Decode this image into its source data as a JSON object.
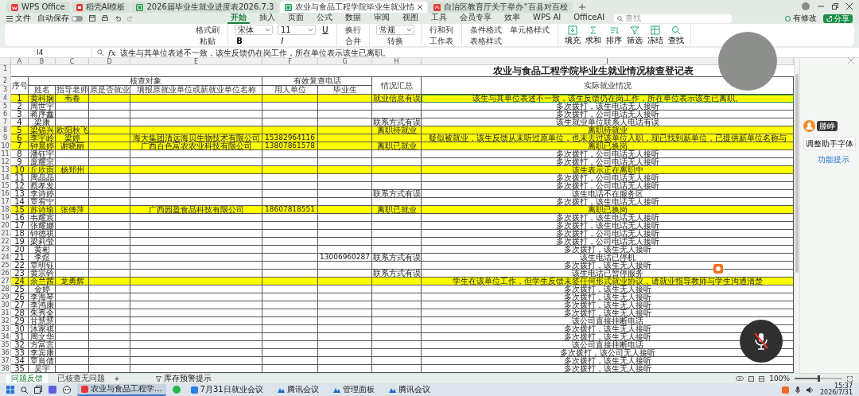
{
  "window_tabs": [
    {
      "label": "WPS Office",
      "kind": "home",
      "selected": false
    },
    {
      "label": "稻壳AI模板",
      "kind": "doc",
      "selected": false
    },
    {
      "label": "2026届毕业生就业进度表2026.7.3",
      "kind": "sheet",
      "selected": false
    },
    {
      "label": "农业与食品工程学院毕业生就业情",
      "kind": "sheet",
      "selected": true
    },
    {
      "label": "自治区教育厅关于举办“百县对百校",
      "kind": "pdf",
      "selected": false
    }
  ],
  "menu": {
    "file": "文件",
    "autosave": {
      "label": "自动保存",
      "on": false
    },
    "tabs": [
      {
        "label": "开始",
        "selected": true
      },
      {
        "label": "插入",
        "selected": false
      },
      {
        "label": "页面",
        "selected": false
      },
      {
        "label": "公式",
        "selected": false
      },
      {
        "label": "数据",
        "selected": false
      },
      {
        "label": "审阅",
        "selected": false
      },
      {
        "label": "视图",
        "selected": false
      },
      {
        "label": "工具",
        "selected": false
      },
      {
        "label": "会员专享",
        "selected": false
      },
      {
        "label": "效率",
        "selected": false
      },
      {
        "label": "WPS AI",
        "selected": false
      },
      {
        "label": "OfficeAI",
        "selected": false
      }
    ],
    "search": {
      "placeholder": "查找"
    },
    "changes": "有修改",
    "share": "分享"
  },
  "ribbon": [
    {
      "items": [
        {
          "kind": "button",
          "label": "格式刷"
        },
        {
          "kind": "button",
          "label": "粘贴"
        }
      ]
    },
    {
      "items": [
        {
          "kind": "select",
          "value": "宋体"
        },
        {
          "kind": "format",
          "label": "B"
        },
        {
          "kind": "select",
          "value": "11"
        },
        {
          "kind": "format",
          "label": "I"
        },
        {
          "kind": "format",
          "label": "U"
        }
      ]
    },
    {
      "items": [
        {
          "kind": "button",
          "label": "换行"
        },
        {
          "kind": "button",
          "label": "合并"
        }
      ]
    },
    {
      "items": [
        {
          "kind": "select",
          "value": "常规"
        },
        {
          "kind": "button",
          "label": "转换"
        }
      ]
    },
    {
      "items": [
        {
          "kind": "button",
          "label": "行和列"
        },
        {
          "kind": "button",
          "label": "工作表"
        }
      ]
    },
    {
      "items": [
        {
          "kind": "button",
          "label": "条件格式"
        },
        {
          "kind": "button",
          "label": "表格样式"
        },
        {
          "kind": "button",
          "label": "单元格样式"
        }
      ]
    },
    {
      "items": [
        {
          "kind": "large",
          "label": "填充"
        },
        {
          "kind": "large",
          "label": "求和"
        },
        {
          "kind": "large",
          "label": "排序"
        },
        {
          "kind": "large",
          "label": "筛选"
        },
        {
          "kind": "large",
          "label": "冻结"
        },
        {
          "kind": "large",
          "label": "查找"
        }
      ]
    }
  ],
  "formula_bar": {
    "cell": "I4",
    "fx": "fx",
    "formula": "该生与其单位表述不一致，该生反馈仍在岗工作，所在单位表示该生已离职。"
  },
  "sheet": {
    "column_letters": [
      "A",
      "B",
      "C",
      "D",
      "E",
      "F",
      "G",
      "H",
      "I"
    ],
    "header_row_numbers": [
      "1",
      "2",
      "3"
    ],
    "title": "农业与食品工程学院毕业生就业情况核查登记表",
    "seq_header": "序号",
    "group_headers": [
      "核查对象",
      "有效复查电话"
    ],
    "column_headers": [
      "姓名",
      "指导老师",
      "原是否就业",
      "填报原就业单位或新就业单位名称",
      "用人单位",
      "毕业生"
    ],
    "summary_header": "情况汇总",
    "actual_header": "实际就业情况",
    "rows": [
      {
        "row": "4",
        "seq": "1",
        "name": "黄科娴",
        "teacher": "韦春",
        "summary": "就业信息有误",
        "actual": "该生与其单位表述不一致，该生反馈仍在岗工作，所在单位表示该生已离职。",
        "highlighted": true,
        "selected": true
      },
      {
        "row": "5",
        "seq": "2",
        "name": "周世宇",
        "actual": "多次拨打，该生电话无人接听",
        "highlighted": false,
        "selected": false
      },
      {
        "row": "6",
        "seq": "3",
        "name": "蒋序鑫",
        "actual": "多次拨打，公司电话无人接听",
        "highlighted": false,
        "selected": false
      },
      {
        "row": "7",
        "seq": "4",
        "name": "梁康",
        "summary": "联系方式有误",
        "actual": "该生就业单位联系人电话有误",
        "highlighted": false,
        "selected": false
      },
      {
        "row": "8",
        "seq": "5",
        "name": "梁锦兴",
        "teacher": "欧阳秋飞",
        "summary": "离职待就业",
        "actual": "离职待就业",
        "highlighted": true,
        "selected": false
      },
      {
        "row": "9",
        "seq": "6",
        "name": "李宇岭",
        "teacher": "梁婷",
        "company": "海大集团清远海贝生物技术有限公司",
        "employer_phone": "15382964116",
        "actual": "疑似被就业，该生反馈从未听过原单位，也未去过该单位入职，现已找到新单位，已提供新单位名称与",
        "highlighted": true,
        "selected": false
      },
      {
        "row": "10",
        "seq": "7",
        "name": "钟晨婷",
        "teacher": "谢晓丽",
        "company": "广西百色富农农业科技有限公司",
        "employer_phone": "13807861578",
        "summary": "离职已就业",
        "actual": "离职已换岗",
        "highlighted": true,
        "selected": false
      },
      {
        "row": "11",
        "seq": "8",
        "name": "潘钰宇",
        "actual": "多次拨打，公司电话无人接听",
        "highlighted": false,
        "selected": false
      },
      {
        "row": "12",
        "seq": "9",
        "name": "庞耀宗",
        "actual": "多次拨打，公司电话无人接听",
        "highlighted": false,
        "selected": false
      },
      {
        "row": "13",
        "seq": "10",
        "name": "丘欣雨",
        "teacher": "杨郑州",
        "actual": "该生表示正在离职中",
        "highlighted": true,
        "selected": false
      },
      {
        "row": "14",
        "seq": "11",
        "name": "周晶晶",
        "actual": "多次拨打，公司电话无人接听",
        "highlighted": false,
        "selected": false
      },
      {
        "row": "15",
        "seq": "12",
        "name": "蔡孝发",
        "actual": "多次拨打，公司电话无人接听",
        "highlighted": false,
        "selected": false
      },
      {
        "row": "16",
        "seq": "13",
        "name": "李诗婷",
        "summary": "联系方式有误",
        "actual": "该生电话不在服务区",
        "highlighted": false,
        "selected": false
      },
      {
        "row": "17",
        "seq": "14",
        "name": "覃宥宁",
        "actual": "多次拨打，该生电话无人接听",
        "highlighted": false,
        "selected": false
      },
      {
        "row": "18",
        "seq": "15",
        "name": "苏诗瑜",
        "teacher": "张傅萍",
        "company": "广西园盈食品科技有限公司",
        "employer_phone": "18607818551",
        "summary": "离职已就业",
        "actual": "离职已换岗",
        "highlighted": true,
        "selected": false
      },
      {
        "row": "19",
        "seq": "16",
        "name": "韦耀宸",
        "actual": "多次拨打，该生电话无人接听",
        "highlighted": false,
        "selected": false
      },
      {
        "row": "20",
        "seq": "17",
        "name": "张耀娜",
        "actual": "多次拨打，该生电话无人接听",
        "highlighted": false,
        "selected": false
      },
      {
        "row": "21",
        "seq": "18",
        "name": "钟德祺",
        "actual": "多次拨打，公司电话无人接听",
        "highlighted": false,
        "selected": false
      },
      {
        "row": "22",
        "seq": "19",
        "name": "梁莉莹",
        "actual": "多次拨打，公司电话无人接听",
        "highlighted": false,
        "selected": false
      },
      {
        "row": "23",
        "seq": "20",
        "name": "黄彬",
        "actual": "多次拨打，该生无人接听",
        "highlighted": false,
        "selected": false
      },
      {
        "row": "24",
        "seq": "21",
        "name": "李煜",
        "graduate_phone": "13006960287",
        "summary": "联系方式有误",
        "actual": "该生电话已停机",
        "highlighted": false,
        "selected": false
      },
      {
        "row": "25",
        "seq": "22",
        "name": "覃明钰",
        "actual": "多次拨打，该生无人接听",
        "highlighted": false,
        "selected": false
      },
      {
        "row": "26",
        "seq": "23",
        "name": "黄宗钤",
        "summary": "联系方式有误",
        "actual": "该生电话已暂停服务",
        "highlighted": false,
        "selected": false
      },
      {
        "row": "27",
        "seq": "24",
        "name": "余兰茜",
        "teacher": "龙勇辉",
        "actual": "学生在该单位工作，但学生反馈未签任何形式就业协议，请就业指导教师与学生沟通清楚",
        "highlighted": true,
        "selected": false
      },
      {
        "row": "28",
        "seq": "25",
        "name": "金婷",
        "actual": "多次拨打，该生无人接听",
        "highlighted": false,
        "selected": false
      },
      {
        "row": "29",
        "seq": "26",
        "name": "李海琴",
        "actual": "多次拨打，该生无人接听",
        "highlighted": false,
        "selected": false
      },
      {
        "row": "30",
        "seq": "27",
        "name": "李鸿康",
        "actual": "多次拨打，该生无人接听",
        "highlighted": false,
        "selected": false
      },
      {
        "row": "31",
        "seq": "28",
        "name": "朱秀全",
        "actual": "多次拨打，该生无人接听",
        "highlighted": false,
        "selected": false
      },
      {
        "row": "32",
        "seq": "29",
        "name": "甘慧慧",
        "actual": "该公司直接挂断电话",
        "highlighted": false,
        "selected": false
      },
      {
        "row": "33",
        "seq": "30",
        "name": "沐家祺",
        "actual": "多次拨打，该生无人接听",
        "highlighted": false,
        "selected": false
      },
      {
        "row": "34",
        "seq": "31",
        "name": "周文华",
        "actual": "多次拨打，该生无人接听",
        "highlighted": false,
        "selected": false
      },
      {
        "row": "35",
        "seq": "32",
        "name": "方富言",
        "actual": "该公司直接挂断电话",
        "highlighted": false,
        "selected": false
      },
      {
        "row": "36",
        "seq": "33",
        "name": "李宾康",
        "actual": "多次拨打，该公司无人接听",
        "highlighted": false,
        "selected": false
      },
      {
        "row": "37",
        "seq": "34",
        "name": "覃肖倩",
        "actual": "多次拨打，该生无人接听",
        "highlighted": false,
        "selected": false
      },
      {
        "row": "38",
        "seq": "35",
        "name": "吴宇",
        "actual": "多次拨打，该生无人接听",
        "highlighted": false,
        "selected": false
      }
    ]
  },
  "side_panel": {
    "participant": "滕峥",
    "font_button": "调整助手字体",
    "tip_link": "功能提示"
  },
  "status_bar": {
    "sheet_tabs": [
      {
        "label": "问题反馈",
        "selected": true
      },
      {
        "label": "已核查无问题",
        "selected": false
      }
    ],
    "add_sheet": "+",
    "hint": "库存预警提示",
    "zoom": "100%",
    "zoom_slider": {
      "level": 0.5
    }
  },
  "taskbar": {
    "items": [
      {
        "label": "农业与食品工程学...",
        "active": true
      },
      {
        "label": "7月31日就业会议",
        "active": false
      },
      {
        "label": "腾讯会议",
        "active": false
      },
      {
        "label": "管理面板",
        "active": false
      },
      {
        "label": "腾讯会议",
        "active": false
      }
    ],
    "time": "15:37",
    "date": "2026/7/31"
  }
}
